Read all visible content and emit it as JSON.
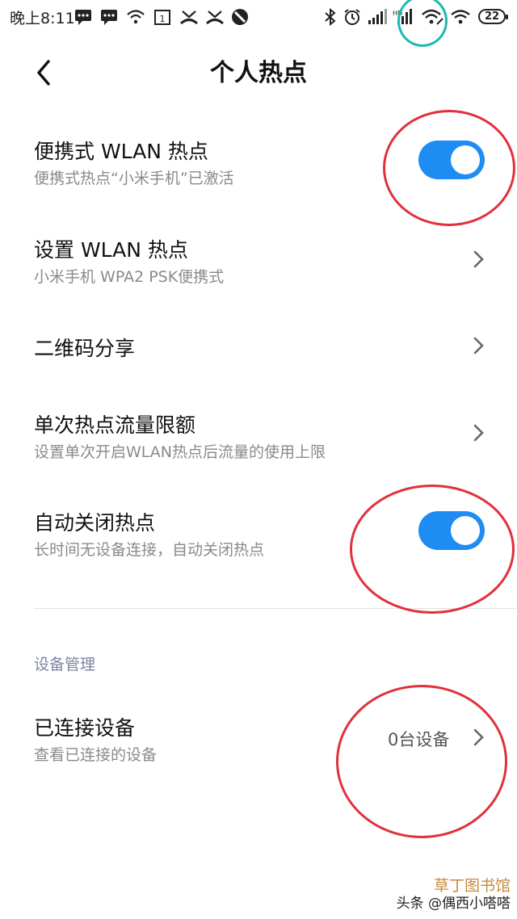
{
  "status_bar": {
    "time": "晚上8:11",
    "battery": "22",
    "icons": [
      "message-icon",
      "message-icon",
      "wifi-icon",
      "calendar-icon",
      "missed-call-icon",
      "missed-call-icon",
      "block-icon",
      "bluetooth-icon",
      "alarm-icon",
      "signal-icon",
      "signal-icon",
      "hotspot-wifi-icon",
      "wifi-icon",
      "battery-icon"
    ]
  },
  "header": {
    "title": "个人热点"
  },
  "items": [
    {
      "title": "便携式 WLAN 热点",
      "subtitle": "便携式热点“小米手机”已激活",
      "control": "toggle",
      "on": true
    },
    {
      "title": "设置 WLAN 热点",
      "subtitle": "小米手机 WPA2 PSK便携式",
      "control": "chevron"
    },
    {
      "title": "二维码分享",
      "control": "chevron"
    },
    {
      "title": "单次热点流量限额",
      "subtitle": "设置单次开启WLAN热点后流量的使用上限",
      "control": "chevron"
    },
    {
      "title": "自动关闭热点",
      "subtitle": "长时间无设备连接，自动关闭热点",
      "control": "toggle",
      "on": true
    }
  ],
  "section": {
    "label": "设备管理"
  },
  "connected": {
    "title": "已连接设备",
    "subtitle": "查看已连接的设备",
    "value": "0台设备"
  },
  "watermark": {
    "line1": "草丁图书馆",
    "line2": "头条 @偶西小嗒嗒"
  },
  "colors": {
    "toggle_on": "#1e8cf2",
    "annotation_red": "#e0313c",
    "annotation_cyan": "#1fb8b3",
    "section_label": "#7b86a0"
  }
}
